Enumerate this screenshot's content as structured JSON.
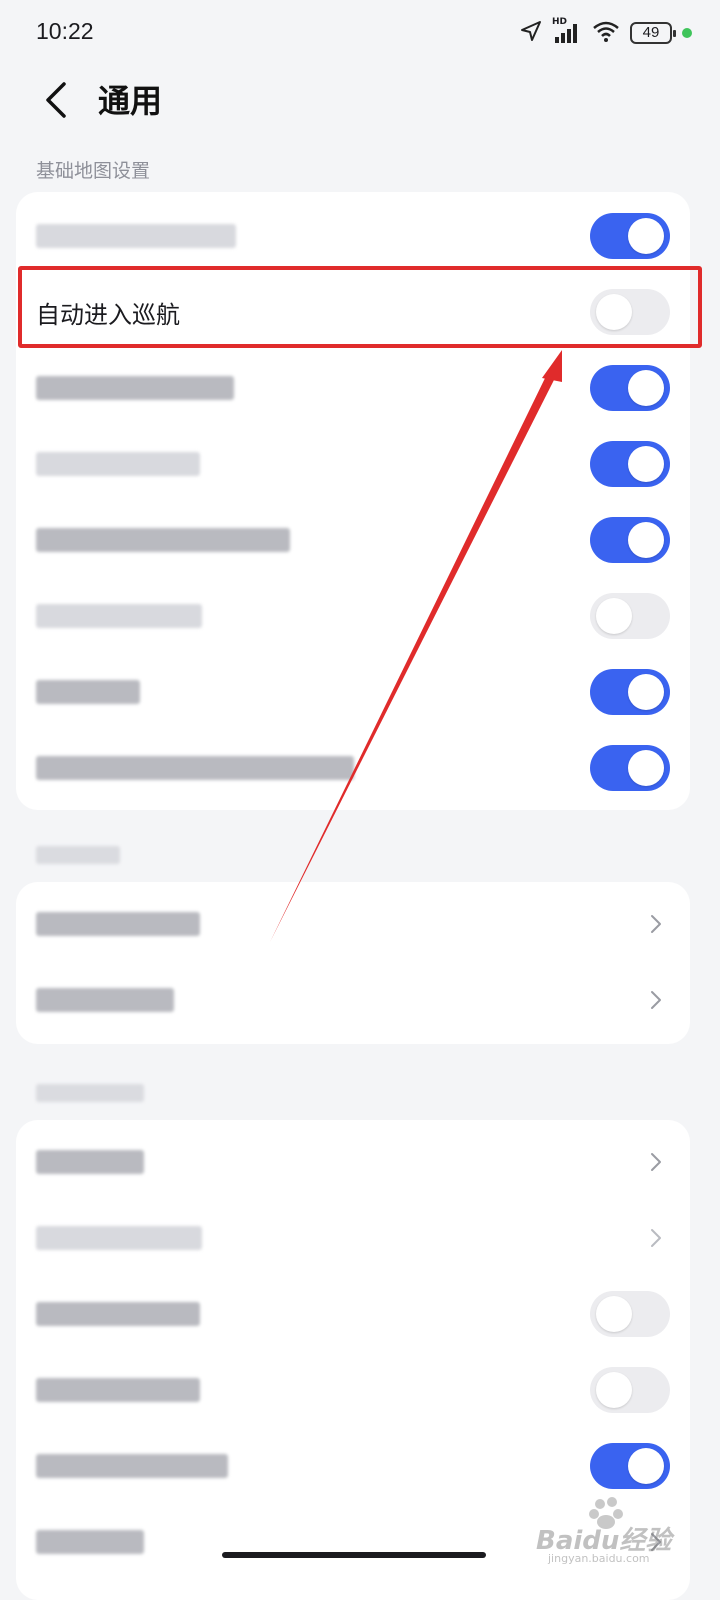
{
  "status_bar": {
    "time": "10:22",
    "network_badge": "HD",
    "battery_level": "49"
  },
  "header": {
    "title": "通用"
  },
  "sections": [
    {
      "label": "基础地图设置",
      "rows": [
        {
          "label": "",
          "control": "toggle",
          "on": true
        },
        {
          "label": "自动进入巡航",
          "control": "toggle",
          "on": false
        },
        {
          "label": "",
          "control": "toggle",
          "on": true
        },
        {
          "label": "",
          "control": "toggle",
          "on": true
        },
        {
          "label": "",
          "control": "toggle",
          "on": true
        },
        {
          "label": "",
          "control": "toggle",
          "on": false
        },
        {
          "label": "",
          "control": "toggle",
          "on": true
        },
        {
          "label": "",
          "control": "toggle",
          "on": true
        }
      ]
    },
    {
      "label": "",
      "rows": [
        {
          "label": "",
          "control": "chevron"
        },
        {
          "label": "",
          "control": "chevron"
        }
      ]
    },
    {
      "label": "",
      "rows": [
        {
          "label": "",
          "control": "chevron"
        },
        {
          "label": "",
          "control": "chevron"
        },
        {
          "label": "",
          "control": "toggle",
          "on": false
        },
        {
          "label": "",
          "control": "toggle",
          "on": false
        },
        {
          "label": "",
          "control": "toggle",
          "on": true
        },
        {
          "label": "",
          "control": "chevron"
        }
      ]
    }
  ],
  "watermark": {
    "brand": "Baidu经验",
    "url": "jingyan.baidu.com"
  },
  "colors": {
    "accent": "#3a63f0",
    "highlight": "#e02b2b",
    "background": "#f4f5f7",
    "card": "#ffffff"
  }
}
